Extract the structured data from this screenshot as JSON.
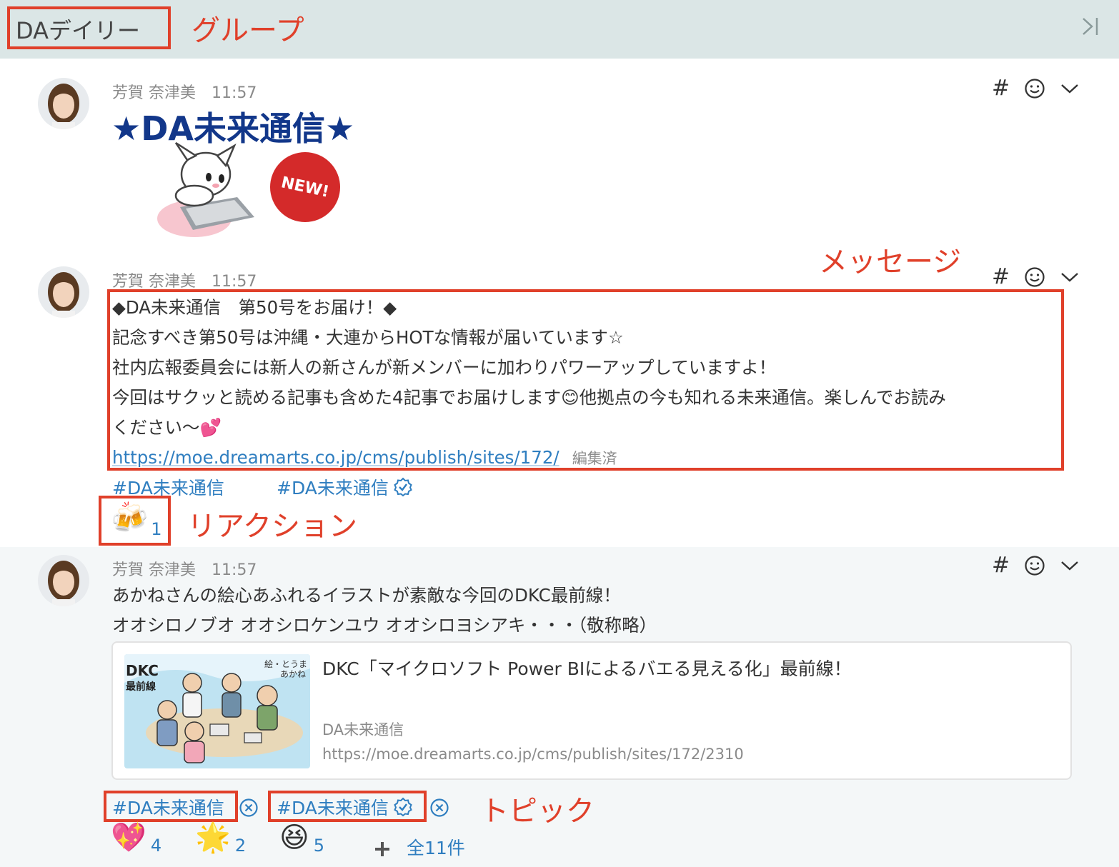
{
  "header": {
    "group_name": "DAデイリー"
  },
  "annotations": {
    "group": "グループ",
    "message": "メッセージ",
    "reaction": "リアクション",
    "topic": "トピック"
  },
  "messages": [
    {
      "author": "芳賀 奈津美",
      "time": "11:57",
      "banner": {
        "title": "★DA未来通信★",
        "badge": "NEW!"
      }
    },
    {
      "author": "芳賀 奈津美",
      "time": "11:57",
      "lines": [
        "◆DA未来通信　第50号をお届け！◆",
        "記念すべき第50号は沖縄・大連からHOTな情報が届いています☆",
        "社内広報委員会には新人の新さんが新メンバーに加わりパワーアップしていますよ！",
        "今回はサクッと読める記事も含めた4記事でお届けします😊他拠点の今も知れる未来通信。楽しんでお読み",
        "ください〜💕"
      ],
      "link": "https://moe.dreamarts.co.jp/cms/publish/sites/172/",
      "edited": "編集済",
      "tags": [
        "#DA未来通信",
        "#DA未来通信"
      ],
      "reaction": {
        "emoji": "🍻",
        "count": "1"
      }
    },
    {
      "author": "芳賀 奈津美",
      "time": "11:57",
      "lines": [
        "あかねさんの絵心あふれるイラストが素敵な今回のDKC最前線！",
        "オオシロノブオ オオシロケンユウ オオシロヨシアキ・・・（敬称略）"
      ],
      "card": {
        "title": "DKC「マイクロソフト Power BIによるバエる見える化」最前線！",
        "site": "DA未来通信",
        "url": "https://moe.dreamarts.co.jp/cms/publish/sites/172/2310",
        "thumb_text": "DKC 最前線",
        "thumb_caption": "絵・とうま あかね"
      },
      "tags": [
        "#DA未来通信",
        "#DA未来通信"
      ],
      "reactions": [
        {
          "emoji": "💖",
          "count": "4"
        },
        {
          "emoji": "🌟",
          "count": "2"
        },
        {
          "emoji": "😆",
          "count": "5"
        }
      ],
      "all_reactions": "全11件"
    }
  ],
  "icons": {
    "hash": "#",
    "collapse": "collapse-right-icon",
    "emoji_add": "smiley-icon",
    "more": "chevron-down-icon",
    "verified": "verified-check-icon",
    "remove": "remove-circle-icon",
    "add": "plus-icon"
  },
  "colors": {
    "accent": "#2f7ec0",
    "annotation": "#e0402a",
    "banner": "#12378a",
    "header_bg": "#dbe6e6"
  }
}
